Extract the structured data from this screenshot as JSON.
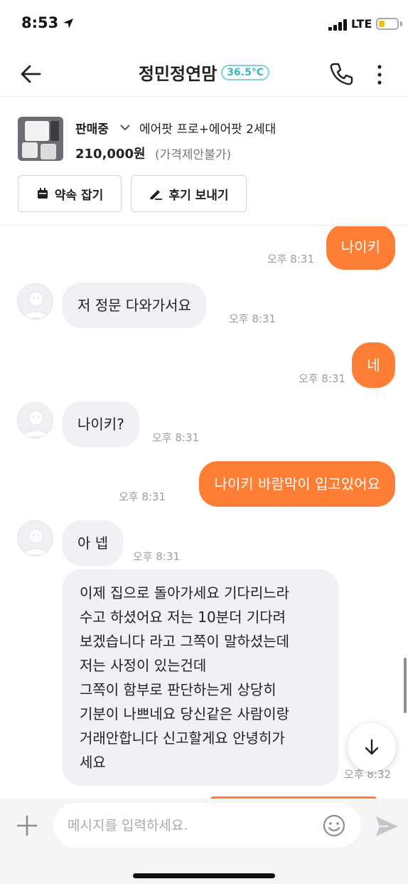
{
  "status_bar": {
    "time": "8:53",
    "network": "LTE"
  },
  "header": {
    "title": "정민정연맘",
    "temperature": "36.5°C"
  },
  "product": {
    "status": "판매중",
    "title": "에어팟 프로+에어팟 2세대",
    "price": "210,000원",
    "negotiation": "(가격제안불가)",
    "buttons": {
      "promise": "약속 잡기",
      "review": "후기 보내기"
    }
  },
  "messages": [
    {
      "sender": "me",
      "text": "나이키",
      "time": "오후 8:31"
    },
    {
      "sender": "other",
      "text": "저 정문 다와가서요",
      "time": "오후 8:31"
    },
    {
      "sender": "me",
      "text": "네",
      "time": "오후 8:31"
    },
    {
      "sender": "other",
      "text": "나이키?",
      "time": "오후 8:31"
    },
    {
      "sender": "me",
      "text": "나이키 바람막이 입고있어요",
      "time": "오후 8:31"
    },
    {
      "sender": "other",
      "text": "아 넵",
      "time": "오후 8:31"
    },
    {
      "sender": "other",
      "lines": [
        "이제 집으로 돌아가세요 기다리느라",
        "수고 하셨어요 저는 10분더 기다려",
        "보겠습니다 라고 그쪽이 말하셨는데",
        "저는 사정이 있는건데",
        "그쪽이 함부로 판단하는게 상당히",
        "기분이 나쁘네요 당신같은 사람이랑",
        "거래안합니다 신고할게요 안녕히가",
        "세요"
      ],
      "time": "오후 8:32"
    }
  ],
  "composer": {
    "placeholder": "메시지를 입력하세요."
  },
  "colors": {
    "accent": "#ff7e36",
    "other_bubble": "#f0f1f4",
    "temperature": "#3fb4bd"
  },
  "icons": [
    "back-arrow-icon",
    "phone-icon",
    "more-vertical-icon",
    "calendar-icon",
    "pencil-icon",
    "chevron-down-icon",
    "arrow-down-icon",
    "plus-icon",
    "emoji-icon",
    "send-icon"
  ]
}
